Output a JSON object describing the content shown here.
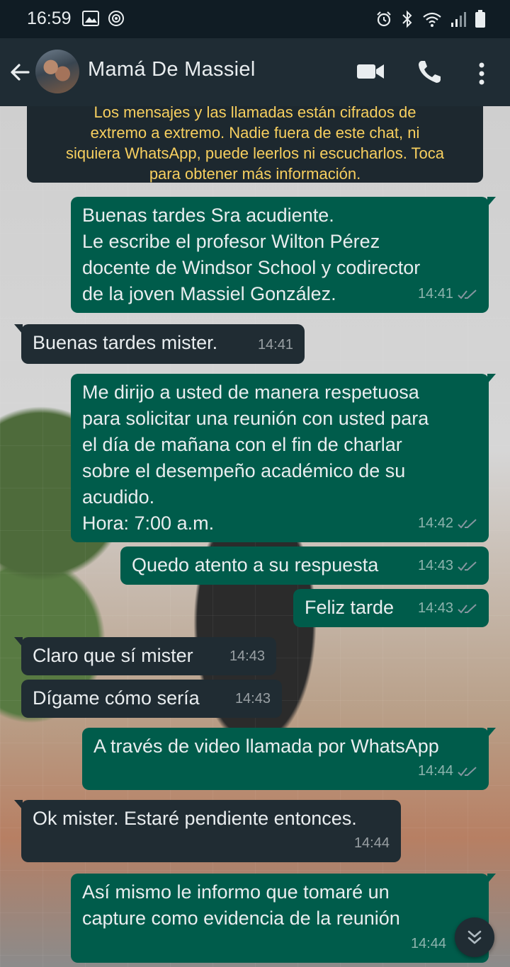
{
  "status_bar": {
    "time": "16:59",
    "left_icons": [
      "gallery-icon",
      "sync-icon"
    ],
    "right_icons": [
      "alarm-icon",
      "bluetooth-icon",
      "wifi-icon",
      "signal-icon",
      "battery-icon"
    ]
  },
  "header": {
    "contact_name": "Mamá De Massiel",
    "icons": [
      "back-arrow-icon",
      "video-call-icon",
      "phone-icon",
      "more-options-icon"
    ]
  },
  "encryption_banner": {
    "lines": [
      "Los mensajes y las llamadas están cifrados de",
      "extremo a extremo. Nadie fuera de este chat, ni",
      "siquiera WhatsApp, puede leerlos ni escucharlos. Toca",
      "para obtener más información."
    ]
  },
  "messages": [
    {
      "direction": "out",
      "text": "Buenas tardes Sra acudiente.\nLe escribe el profesor Wilton Pérez\ndocente de Windsor School y codirector\nde la joven Massiel González.",
      "time": "14:41",
      "read": true
    },
    {
      "direction": "in",
      "text": "Buenas tardes mister.",
      "time": "14:41"
    },
    {
      "direction": "out",
      "text": "Me dirijo a usted de manera respetuosa\npara solicitar una reunión con usted para\nel día de mañana con el fin de charlar\nsobre el desempeño académico de su\nacudido.\nHora: 7:00 a.m.",
      "time": "14:42",
      "read": true
    },
    {
      "direction": "out",
      "text": "Quedo atento a su respuesta",
      "time": "14:43",
      "read": true
    },
    {
      "direction": "out",
      "text": "Feliz tarde",
      "time": "14:43",
      "read": true
    },
    {
      "direction": "in",
      "text": "Claro que sí mister",
      "time": "14:43"
    },
    {
      "direction": "in",
      "text": "Dígame cómo sería",
      "time": "14:43"
    },
    {
      "direction": "out",
      "text": "A través de video llamada por WhatsApp",
      "time": "14:44",
      "read": true
    },
    {
      "direction": "in",
      "text": "Ok mister. Estaré pendiente entonces.",
      "time": "14:44"
    },
    {
      "direction": "out",
      "text": "Así mismo le informo que tomaré un\ncapture como evidencia de la reunión",
      "time": "14:44",
      "read": false
    }
  ],
  "colors": {
    "outgoing_bubble": "#005c4b",
    "incoming_bubble": "#202c33",
    "header_bg": "#1f2c34",
    "banner_text": "#f7cf5f",
    "read_ticks": "#8696a0"
  }
}
